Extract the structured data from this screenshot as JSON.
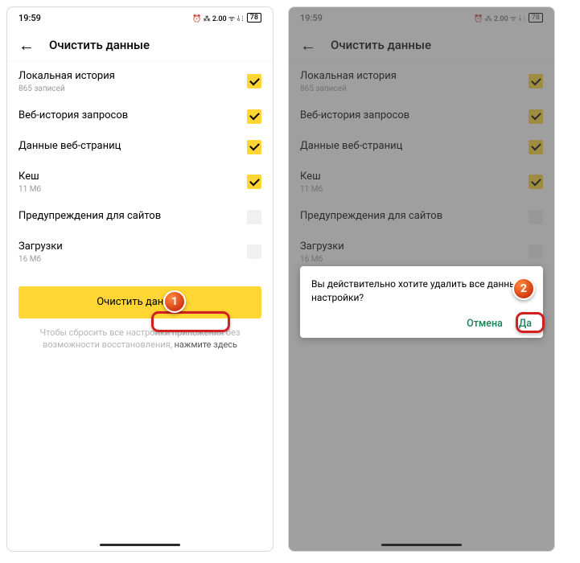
{
  "status": {
    "time": "19:59",
    "icons_text": "⏰ ⁂ 2.00 ᯤ ⫰ ⫶",
    "battery": "78"
  },
  "header": {
    "title": "Очистить данные"
  },
  "items": [
    {
      "label": "Локальная история",
      "sub": "865 записей",
      "checked": true
    },
    {
      "label": "Веб-история запросов",
      "sub": "",
      "checked": true
    },
    {
      "label": "Данные веб-страниц",
      "sub": "",
      "checked": true
    },
    {
      "label": "Кеш",
      "sub": "11 Мб",
      "checked": true
    },
    {
      "label": "Предупреждения для сайтов",
      "sub": "",
      "checked": false
    },
    {
      "label": "Загрузки",
      "sub": "16 Мб",
      "checked": false
    }
  ],
  "action_label": "Очистить данные",
  "reset_hint_prefix": "Чтобы сбросить все настройки приложения без возможности восстановления, ",
  "reset_hint_link": "нажмите здесь",
  "dialog": {
    "message": "Вы действительно хотите удалить все данные и настройки?",
    "cancel": "Отмена",
    "ok": "Да"
  },
  "callouts": {
    "one": "1",
    "two": "2"
  }
}
